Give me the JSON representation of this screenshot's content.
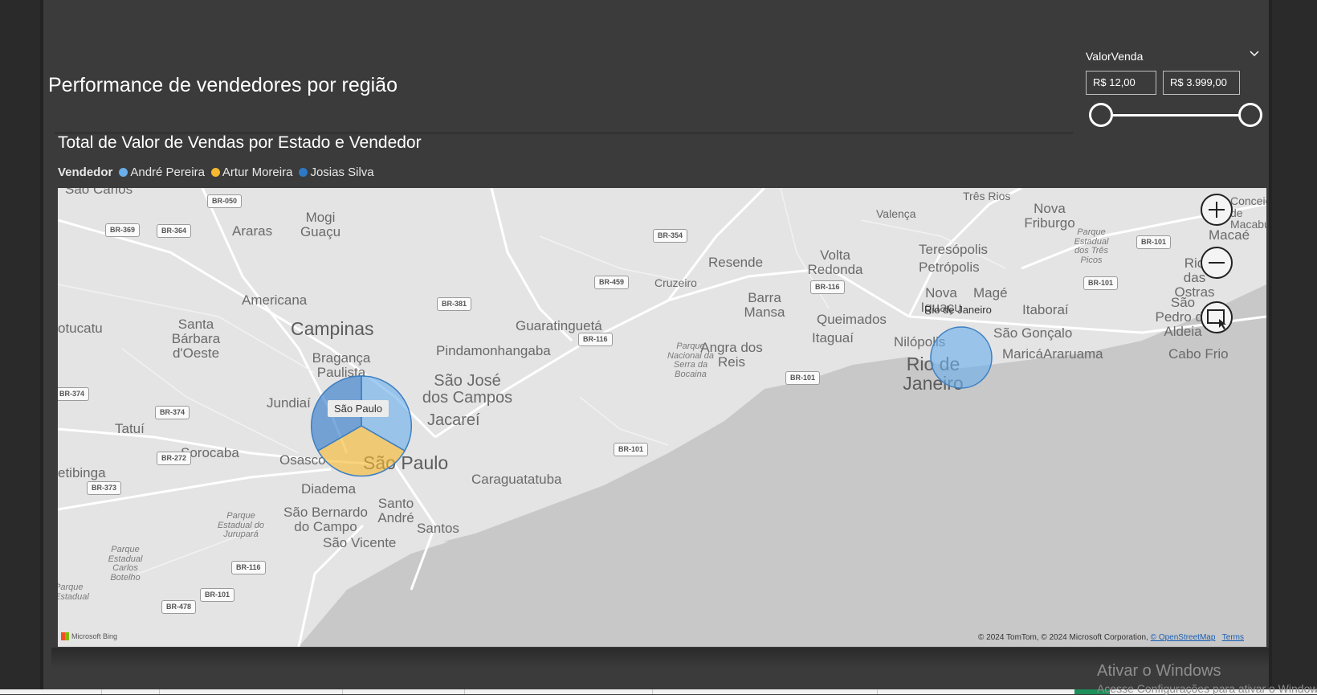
{
  "report": {
    "page_title": "Performance de vendedores por região"
  },
  "slicer": {
    "title": "ValorVenda",
    "min_value": "R$ 12,00",
    "max_value": "R$ 3.999,00",
    "range_selected": [
      0,
      1
    ]
  },
  "visual": {
    "title": "Total de Valor de Vendas por Estado e Vendedor",
    "legend_title": "Vendedor",
    "legend": [
      {
        "name": "André Pereira",
        "color": "#6aaeea"
      },
      {
        "name": "Artur Moreira",
        "color": "#f5b82e"
      },
      {
        "name": "Josias Silva",
        "color": "#2e78c8"
      }
    ],
    "bubbles": [
      {
        "label": "São Paulo",
        "slices": [
          {
            "vendedor": "André Pereira",
            "share": 0.5
          },
          {
            "vendedor": "Artur Moreira",
            "share": 0.33
          },
          {
            "vendedor": "Josias Silva",
            "share": 0.17
          }
        ]
      },
      {
        "label": "Rio de Janeiro",
        "slices": [
          {
            "vendedor": "André Pereira",
            "share": 1.0
          }
        ]
      }
    ],
    "map_labels": [
      "São Carlos",
      "Mogi Guaçu",
      "Araras",
      "Americana",
      "Campinas",
      "Santa Bárbara d'Oeste",
      "otucatu",
      "Bragança Paulista",
      "Jundiaí",
      "Tatuí",
      "Sorocaba",
      "etibinga",
      "Osasco",
      "Diadema",
      "São Bernardo do Campo",
      "Santo André",
      "São Paulo",
      "São Vicente",
      "Santos",
      "Caraguatatuba",
      "São José dos Campos",
      "Jacareí",
      "Pindamonhangaba",
      "Guaratinguetá",
      "Cruzeiro",
      "Resende",
      "Barra Mansa",
      "Volta Redonda",
      "Queimados",
      "Itaguaí",
      "Angra dos Reis",
      "Nilópolis",
      "Rio de Janeiro",
      "Teresópolis",
      "Petrópolis",
      "Nova Iguaçu",
      "Magé",
      "Itaboraí",
      "São Gonçalo",
      "Maricá",
      "Araruama",
      "Cabo Frio",
      "Três Rios",
      "Valença",
      "Nova Friburgo",
      "Macaé",
      "Rio das Ostras",
      "São Pedro da Aldeia",
      "Conceição de Macabu",
      "Parque Estadual dos Três Picos",
      "Parque Nacional da Serra da Bocaina",
      "Parque Estadual do Jurupará",
      "Parque Estadual Carlos Botelho",
      "Parque Estadual"
    ],
    "road_shields": [
      "BR-050",
      "BR-369",
      "BR-364",
      "BR-354",
      "BR-459",
      "BR-381",
      "BR-116",
      "BR-116",
      "BR-101",
      "BR-101",
      "BR-101",
      "BR-374",
      "BR-374",
      "BR-272",
      "BR-373",
      "BR-101",
      "BR-116",
      "BR-101",
      "BR-478",
      "BR-101"
    ],
    "tooltips": {
      "sao_paulo": "São Paulo",
      "rio": "Rio de Janeiro"
    },
    "attribution": "© 2024 TomTom, © 2024 Microsoft Corporation,",
    "attribution_link": "© OpenStreetMap",
    "terms": "Terms",
    "bing_logo": "Microsoft Bing",
    "icons": {
      "zoom_in": "plus-icon",
      "zoom_out": "minus-icon",
      "select": "map-select-icon",
      "chevron": "chevron-down-icon"
    }
  },
  "windows_watermark": {
    "title": "Ativar o Windows",
    "subtitle": "Acesse Configurações para ativar o Windows."
  }
}
